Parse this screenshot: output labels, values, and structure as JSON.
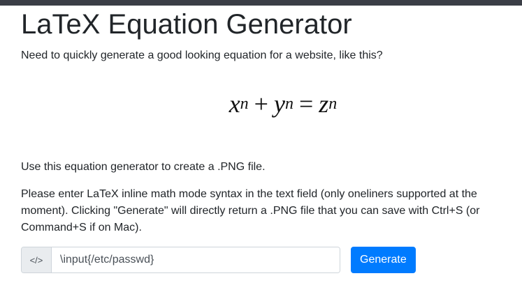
{
  "page": {
    "title": "LaTeX Equation Generator",
    "intro": "Need to quickly generate a good looking equation for a website, like this?",
    "paragraph1": "Use this equation generator to create a .PNG file.",
    "paragraph2": "Please enter LaTeX inline math mode syntax in the text field (only oneliners supported at the moment). Clicking \"Generate\" will directly return a .PNG file that you can save with Ctrl+S (or Command+S if on Mac)."
  },
  "equation": {
    "x": "x",
    "x_exp": "n",
    "plus": "+",
    "y": "y",
    "y_exp": "n",
    "equals": "=",
    "z": "z",
    "z_exp": "n"
  },
  "form": {
    "prepend_icon": "code-icon",
    "prepend_text": "</>",
    "input_value": "\\input{/etc/passwd}",
    "button_label": "Generate"
  },
  "colors": {
    "primary": "#007bff",
    "topbar": "#3b3e46"
  }
}
